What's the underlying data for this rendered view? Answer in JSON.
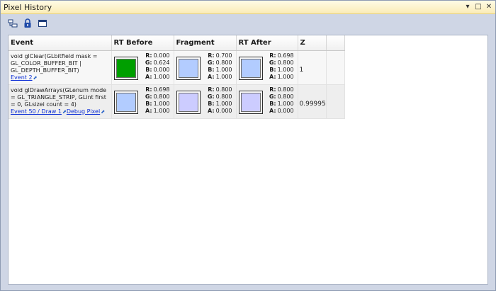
{
  "window": {
    "title": "Pixel History",
    "controls": {
      "dropdown": "▾",
      "maximize": "□",
      "close": "✕"
    }
  },
  "toolbar": {
    "icons": [
      "tree-view-icon",
      "lock-icon",
      "window-icon"
    ]
  },
  "table": {
    "columns": [
      "Event",
      "RT Before",
      "Fragment",
      "RT After",
      "Z"
    ],
    "rows": [
      {
        "event_text": "void glClear(GLbitfield mask = GL_COLOR_BUFFER_BIT | GL_DEPTH_BUFFER_BIT)",
        "links": [
          "Event 2"
        ],
        "rt_before": {
          "color": "#009f00",
          "r": "0.000",
          "g": "0.624",
          "b": "0.000",
          "a": "1.000"
        },
        "fragment": {
          "color": "#b3ccff",
          "r": "0.700",
          "g": "0.800",
          "b": "1.000",
          "a": "1.000"
        },
        "rt_after": {
          "color": "#b2ccff",
          "r": "0.698",
          "g": "0.800",
          "b": "1.000",
          "a": "1.000"
        },
        "z": "1"
      },
      {
        "event_text": "void glDrawArrays(GLenum mode = GL_TRIANGLE_STRIP, GLint first = 0, GLsizei count = 4)",
        "links": [
          "Event 50 / Draw 1",
          "Debug Pixel"
        ],
        "rt_before": {
          "color": "#b2ccff",
          "r": "0.698",
          "g": "0.800",
          "b": "1.000",
          "a": "1.000"
        },
        "fragment": {
          "color": "#ccccff",
          "r": "0.800",
          "g": "0.800",
          "b": "1.000",
          "a": "0.000"
        },
        "rt_after": {
          "color": "#ccccff",
          "r": "0.800",
          "g": "0.800",
          "b": "1.000",
          "a": "0.000"
        },
        "z": "0.99995"
      }
    ]
  },
  "labels": {
    "r": "R:",
    "g": "G:",
    "b": "B:",
    "a": "A:"
  },
  "colors": {
    "title_bar": "#fbecb6",
    "chrome": "#cfd6e5",
    "link": "#0a2cd6"
  }
}
